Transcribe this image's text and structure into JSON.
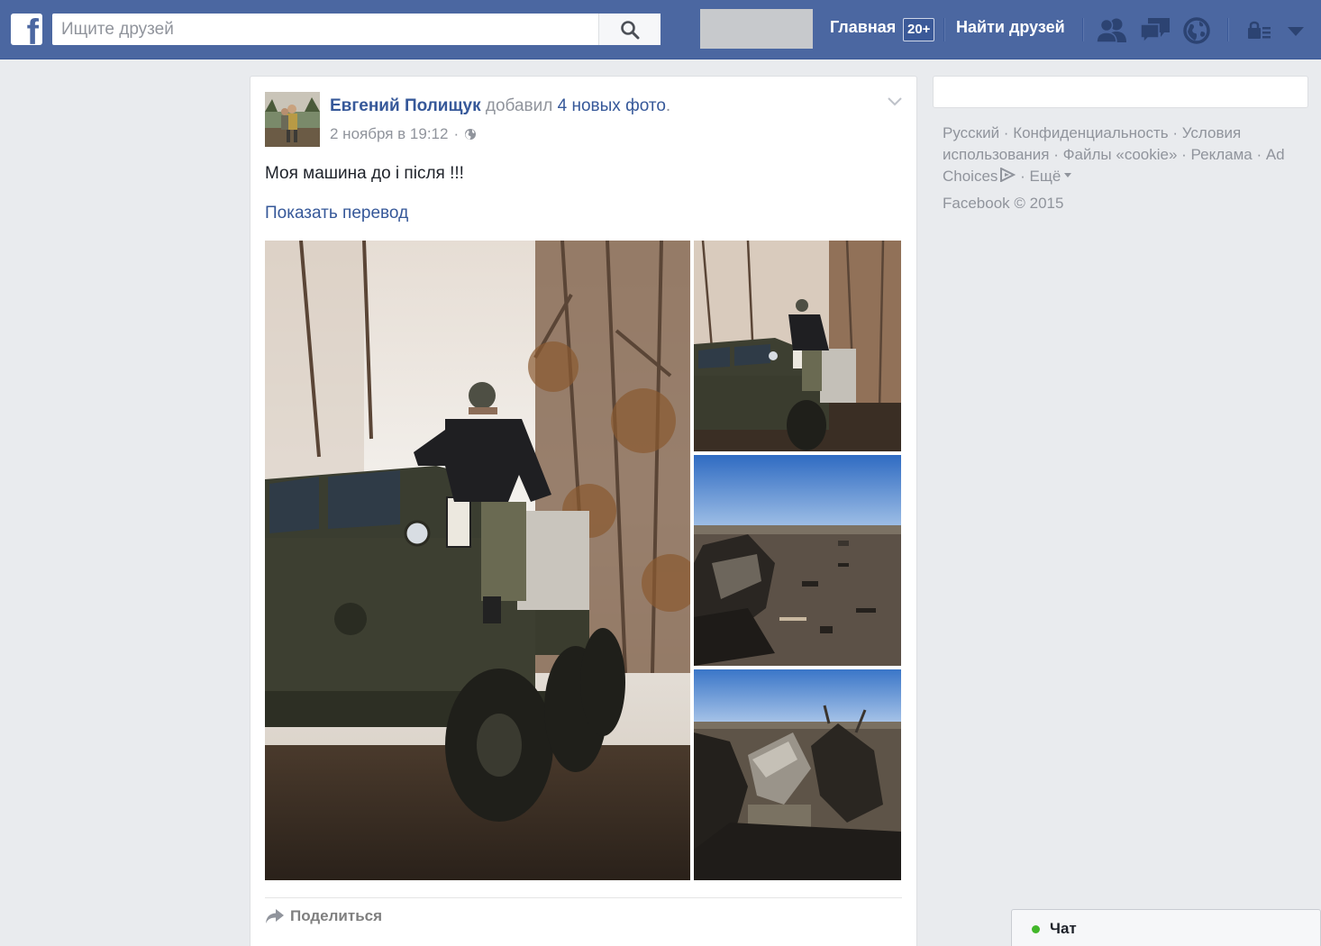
{
  "topbar": {
    "logo_letter": "f",
    "search_placeholder": "Ищите друзей",
    "home_label": "Главная",
    "home_badge": "20+",
    "find_friends_label": "Найти друзей",
    "icons": [
      "friend-requests-icon",
      "messages-icon",
      "notifications-globe-icon",
      "privacy-lock-icon",
      "account-dropdown-icon"
    ],
    "brand_color": "#4b67a1"
  },
  "post": {
    "author": "Евгений Полищук",
    "action": "добавил",
    "action_link": "4 новых фото",
    "action_end": ".",
    "timestamp": "2 ноября в 19:12",
    "audience_icon": "globe-icon",
    "text": "Моя машина до і після !!!",
    "translate_label": "Показать перевод",
    "photos_count": 4,
    "share_label": "Поделиться"
  },
  "right": {
    "footer_links": [
      "Русский",
      "Конфиденциальность",
      "Условия использования",
      "Файлы «cookie»",
      "Реклама",
      "Ad Choices",
      "Ещё"
    ],
    "separator": " · ",
    "copyright": "Facebook © 2015"
  },
  "chat": {
    "label": "Чат",
    "status_color": "#42b72a"
  }
}
